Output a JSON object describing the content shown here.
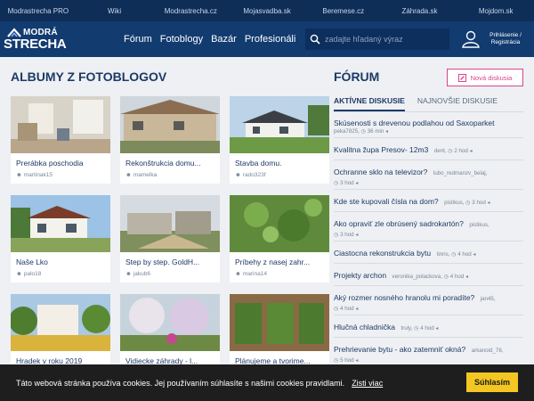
{
  "topbar": {
    "links": [
      "Modrastrecha PRO",
      "Wiki",
      "Modrastrecha.cz",
      "Mojasvadba.sk",
      "Beremese.cz",
      "Záhrada.sk",
      "Mojdom.sk"
    ]
  },
  "header": {
    "logo_line1": "MODRÁ",
    "logo_line2": "STRECHA",
    "nav": [
      "Fórum",
      "Fotoblogy",
      "Bazár",
      "Profesionáli"
    ],
    "search_placeholder": "zadajte hľadaný výraz",
    "user_label_1": "Prihlásenie /",
    "user_label_2": "Registrácia"
  },
  "albums": {
    "title": "ALBUMY Z FOTOBLOGOV",
    "items": [
      {
        "title": "Prerábka poschodia",
        "author": "martinak15"
      },
      {
        "title": "Rekonštrukcia domu...",
        "author": "mamelka"
      },
      {
        "title": "Stavba domu.",
        "author": "rado323f"
      },
      {
        "title": "Naše Lko",
        "author": "palo18"
      },
      {
        "title": "Step by step. GoldH...",
        "author": "jakub6"
      },
      {
        "title": "Príbehy z nasej zahr...",
        "author": "marina14"
      },
      {
        "title": "Hradek v roku 2019",
        "author": ""
      },
      {
        "title": "Vidiecke záhrady - l...",
        "author": ""
      },
      {
        "title": "Plánujeme a tvorime...",
        "author": ""
      }
    ]
  },
  "forum": {
    "title": "FÓRUM",
    "new_button": "Nová diskusia",
    "tabs": [
      "AKTÍVNE DISKUSIE",
      "NAJNOVŠIE DISKUSIE"
    ],
    "threads": [
      {
        "title": "Skúsenosti s drevenou podlahou od Saxoparket",
        "line2": "peka7825, ◷ 36 min ◂"
      },
      {
        "title": "Kvalitna župa Presov- 12m3",
        "meta": "dent, ◷ 2 hod ◂"
      },
      {
        "title": "Ochranne sklo na televizor?",
        "meta": "lubo_redmanzv_belaj,",
        "line2": "◷ 3 hod ◂"
      },
      {
        "title": "Kde ste kupovali čísla na dom?",
        "meta": "pistikus, ◷ 3 hod ◂"
      },
      {
        "title": "Ako opraviť zle obrúsený sadrokartón?",
        "meta": "pistikus,",
        "line2": "◷ 3 hod ◂"
      },
      {
        "title": "Ciastocna rekonstrukcia bytu",
        "meta": "tinns, ◷ 4 hod ◂"
      },
      {
        "title": "Projekty archon",
        "meta": "veronika_polackova, ◷ 4 hod ◂"
      },
      {
        "title": "Aký rozmer nosného hranolu mi poradíte?",
        "meta": "jan45,",
        "line2": "◷ 4 hod ◂"
      },
      {
        "title": "Hlučná chladnička",
        "meta": "truly, ◷ 4 hod ◂"
      },
      {
        "title": "Prehrievanie bytu - ako zatemniť okná?",
        "meta": "arkanoid_76,",
        "line2": "◷ 5 hod ◂"
      }
    ]
  },
  "cookie": {
    "text": "Táto webová stránka používa cookies. Jej používaním súhlasíte s našimi cookies pravidlami.",
    "link": "Zisti viac",
    "button": "Súhlasím"
  },
  "colors": {
    "topbar": "#0e2d57",
    "header": "#123b70",
    "accent_pink": "#d9468b",
    "cookie_button": "#f3c622"
  }
}
